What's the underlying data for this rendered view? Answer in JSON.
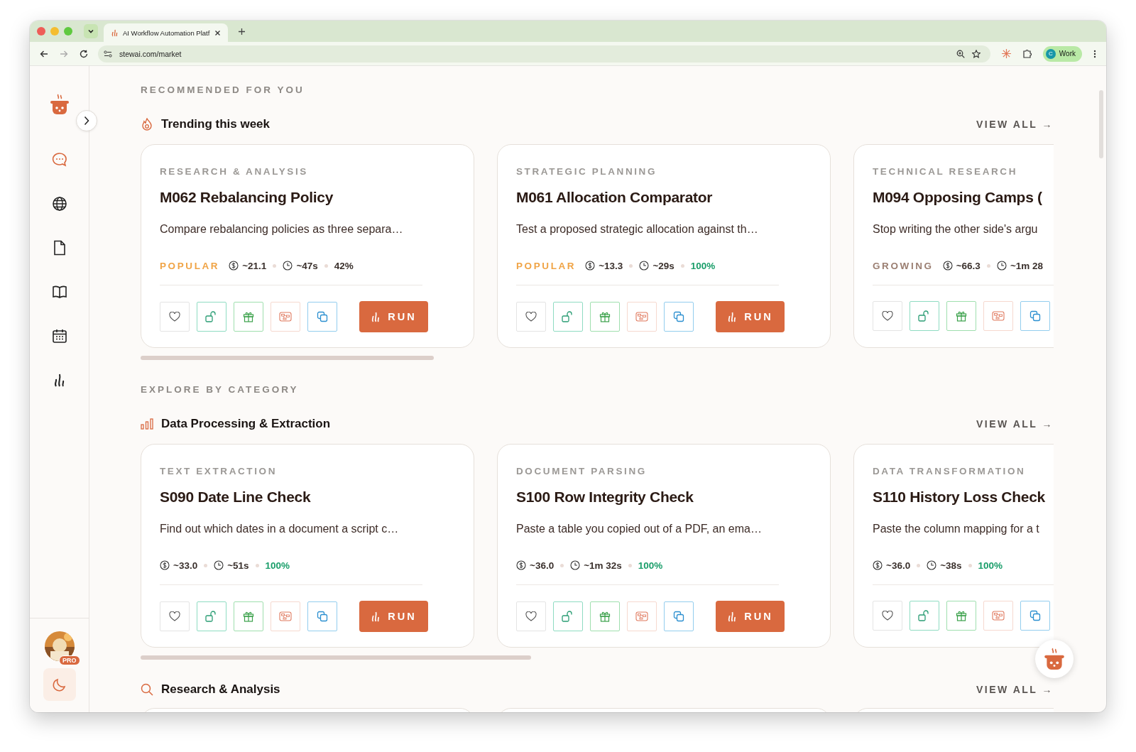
{
  "browser": {
    "tab_title": "AI Workflow Automation Platf",
    "address": "stewai.com/market",
    "profile": {
      "initial": "C",
      "label": "Work"
    }
  },
  "sidebar": {
    "badge": "PRO"
  },
  "sections": [
    {
      "heading": "RECOMMENDED FOR YOU",
      "title": "Trending this week",
      "view_all": "VIEW ALL →",
      "cards": [
        {
          "category": "RESEARCH & ANALYSIS",
          "title": "M062 Rebalancing Policy",
          "description": "Compare rebalancing policies as three separa…",
          "tag": {
            "text": "POPULAR",
            "kind": "popular"
          },
          "cost": "~21.1",
          "time": "~47s",
          "rate": "42%",
          "rate_high": false,
          "run": "RUN"
        },
        {
          "category": "STRATEGIC PLANNING",
          "title": "M061 Allocation Comparator",
          "description": "Test a proposed strategic allocation against th…",
          "tag": {
            "text": "POPULAR",
            "kind": "popular"
          },
          "cost": "~13.3",
          "time": "~29s",
          "rate": "100%",
          "rate_high": true,
          "run": "RUN"
        },
        {
          "category": "TECHNICAL RESEARCH",
          "title": "M094 Opposing Camps (",
          "description": "Stop writing the other side's argu",
          "tag": {
            "text": "GROWING",
            "kind": "growing"
          },
          "cost": "~66.3",
          "time": "~1m 28"
        }
      ]
    },
    {
      "heading": "EXPLORE BY CATEGORY",
      "title": "Data Processing & Extraction",
      "view_all": "VIEW ALL →",
      "cards": [
        {
          "category": "TEXT EXTRACTION",
          "title": "S090 Date Line Check",
          "description": "Find out which dates in a document a script c…",
          "cost": "~33.0",
          "time": "~51s",
          "rate": "100%",
          "rate_high": true,
          "run": "RUN"
        },
        {
          "category": "DOCUMENT PARSING",
          "title": "S100 Row Integrity Check",
          "description": "Paste a table you copied out of a PDF, an ema…",
          "cost": "~36.0",
          "time": "~1m 32s",
          "rate": "100%",
          "rate_high": true,
          "run": "RUN"
        },
        {
          "category": "DATA TRANSFORMATION",
          "title": "S110 History Loss Check",
          "description": "Paste the column mapping for a t",
          "cost": "~36.0",
          "time": "~38s",
          "rate": "100%",
          "rate_high": true
        }
      ]
    },
    {
      "title": "Research & Analysis",
      "view_all": "VIEW ALL →"
    }
  ]
}
